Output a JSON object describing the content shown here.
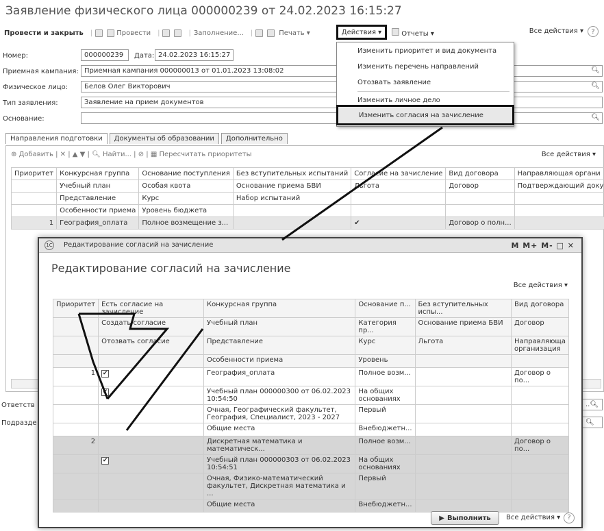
{
  "window": {
    "title": "Заявление физического лица 000000239 от 24.02.2023 16:15:27"
  },
  "toolbar": {
    "post_close": "Провести и закрыть",
    "post": "Провести",
    "fill": "Заполнение...",
    "print": "Печать",
    "actions": "Действия",
    "reports": "Отчеты",
    "all_actions": "Все действия",
    "help": "?"
  },
  "form": {
    "number_label": "Номер:",
    "number_value": "000000239",
    "date_label": "Дата:",
    "date_value": "24.02.2023 16:15:27",
    "campaign_label": "Приемная кампания:",
    "campaign_value": "Приемная кампания 000000013 от 01.01.2023 13:08:02",
    "person_label": "Физическое лицо:",
    "person_value": "Белов Олег Викторович",
    "type_label": "Тип заявления:",
    "type_value": "Заявление на прием документов",
    "basis_label": "Основание:",
    "basis_value": "",
    "resp_label": "Ответств",
    "dept_label": "Подразде"
  },
  "actions_menu": {
    "items": [
      "Изменить приоритет и вид документа",
      "Изменить перечень направлений",
      "Отозвать заявление",
      "Изменить личное дело",
      "Изменить согласия на зачисление"
    ]
  },
  "tabs": [
    "Направления подготовки",
    "Документы об образовании",
    "Дополнительно"
  ],
  "grid_toolbar": {
    "add": "Добавить",
    "find": "Найти...",
    "recalc": "Пересчитать приоритеты",
    "all_actions": "Все действия"
  },
  "bg_grid": {
    "rows": [
      [
        "Приоритет",
        "Конкурсная группа",
        "Основание поступления",
        "Без вступительных испытаний",
        "Согласие на зачисление",
        "Вид договора",
        "Направляющая органи"
      ],
      [
        "",
        "Учебный план",
        "Особая квота",
        "Основание приема БВИ",
        "Льгота",
        "Договор",
        "Подтверждающий доку"
      ],
      [
        "",
        "Представление",
        "Курс",
        "Набор испытаний",
        "",
        "",
        ""
      ],
      [
        "",
        "Особенности приема",
        "Уровень бюджета",
        "",
        "",
        "",
        ""
      ],
      [
        "1",
        "География_оплата",
        "Полное возмещение з...",
        "",
        "✔",
        "Договор о полн...",
        ""
      ]
    ]
  },
  "dialog": {
    "window_title": "Редактирование согласий на зачисление",
    "title_buttons": "M  M+  M-  □  ✕",
    "heading": "Редактирование согласий на зачисление",
    "all_actions": "Все действия",
    "header_rows": [
      [
        "Приоритет",
        "Есть согласие на зачисление",
        "Конкурсная группа",
        "Основание п...",
        "Без вступительных испы...",
        "Вид договора"
      ],
      [
        "",
        "Создать согласие",
        "Учебный план",
        "Категория пр...",
        "Основание приема БВИ",
        "Договор"
      ],
      [
        "",
        "Отозвать согласие",
        "Представление",
        "Курс",
        "Льгота",
        "Направляюща организация"
      ],
      [
        "",
        "",
        "Особенности приема",
        "Уровень",
        "",
        ""
      ]
    ],
    "group1": {
      "priority": "1",
      "check1": "✔",
      "check2": "✔",
      "rows": [
        [
          "География_оплата",
          "Полное возм...",
          "",
          "Договор о по..."
        ],
        [
          "Учебный план 000000300 от 06.02.2023 10:54:50",
          "На общих основаниях",
          "",
          ""
        ],
        [
          "Очная, Географический факультет, География, Специалист, 2023 - 2027",
          "Первый",
          "",
          ""
        ],
        [
          "Общие места",
          "Внебюджетн...",
          "",
          ""
        ]
      ]
    },
    "group2": {
      "priority": "2",
      "check2": "✔",
      "rows": [
        [
          "Дискретная математика и математическ...",
          "Полное возм...",
          "",
          "Договор о по..."
        ],
        [
          "Учебный план 000000303 от 06.02.2023 10:54:51",
          "На общих основаниях",
          "",
          ""
        ],
        [
          "Очная, Физико-математический факультет, Дискретная математика и ...",
          "Первый",
          "",
          ""
        ],
        [
          "Общие места",
          "Внебюджетн...",
          "",
          ""
        ]
      ]
    },
    "execute": "Выполнить",
    "footer_all_actions": "Все действия",
    "help": "?"
  }
}
